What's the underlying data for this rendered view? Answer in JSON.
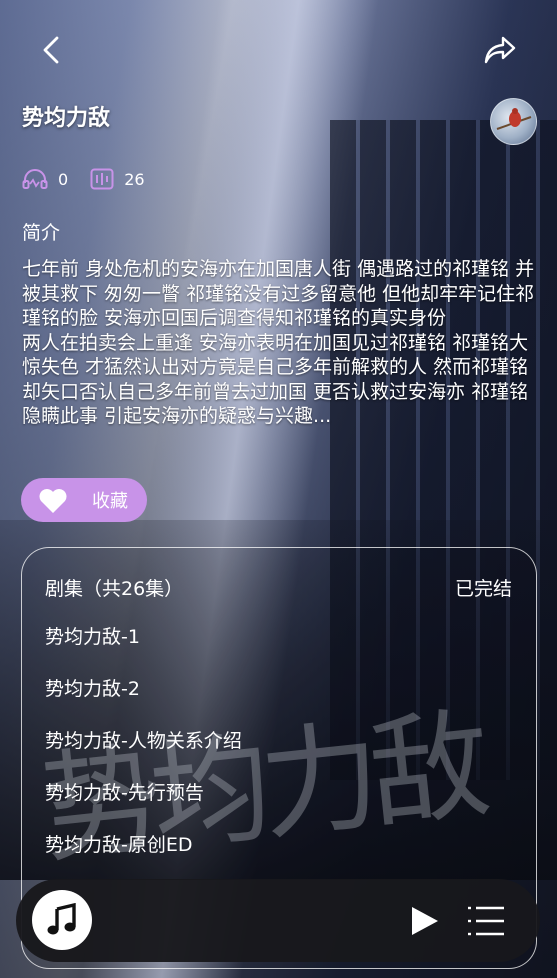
{
  "header": {
    "title": "势均力敌",
    "back_icon": "chevron-left-icon",
    "share_icon": "share-arrow-icon"
  },
  "stats": {
    "listeners": "0",
    "episodes": "26"
  },
  "intro": {
    "label": "简介",
    "paragraph1": "七年前 身处危机的安海亦在加国唐人街 偶遇路过的祁瑾铭 并被其救下 匆匆一瞥 祁瑾铭没有过多留意他 但他却牢牢记住祁瑾铭的脸 安海亦回国后调查得知祁瑾铭的真实身份",
    "paragraph2": "两人在拍卖会上重逢 安海亦表明在加国见过祁瑾铭 祁瑾铭大惊失色 才猛然认出对方竟是自己多年前解救的人 然而祁瑾铭却矢口否认自己多年前曾去过加国 更否认救过安海亦 祁瑾铭隐瞒此事 引起安海亦的疑惑与兴趣..."
  },
  "favorite": {
    "label": "收藏"
  },
  "episode_list": {
    "header": "剧集（共26集）",
    "status": "已完结",
    "items": [
      "势均力敌-1",
      "势均力敌-2",
      "势均力敌-人物关系介绍",
      "势均力敌-先行预告",
      "势均力敌-原创ED"
    ]
  },
  "colors": {
    "accent": "#c893e8",
    "player_bg": "#18181c"
  },
  "background": {
    "calligraphy": "势均力敌"
  }
}
